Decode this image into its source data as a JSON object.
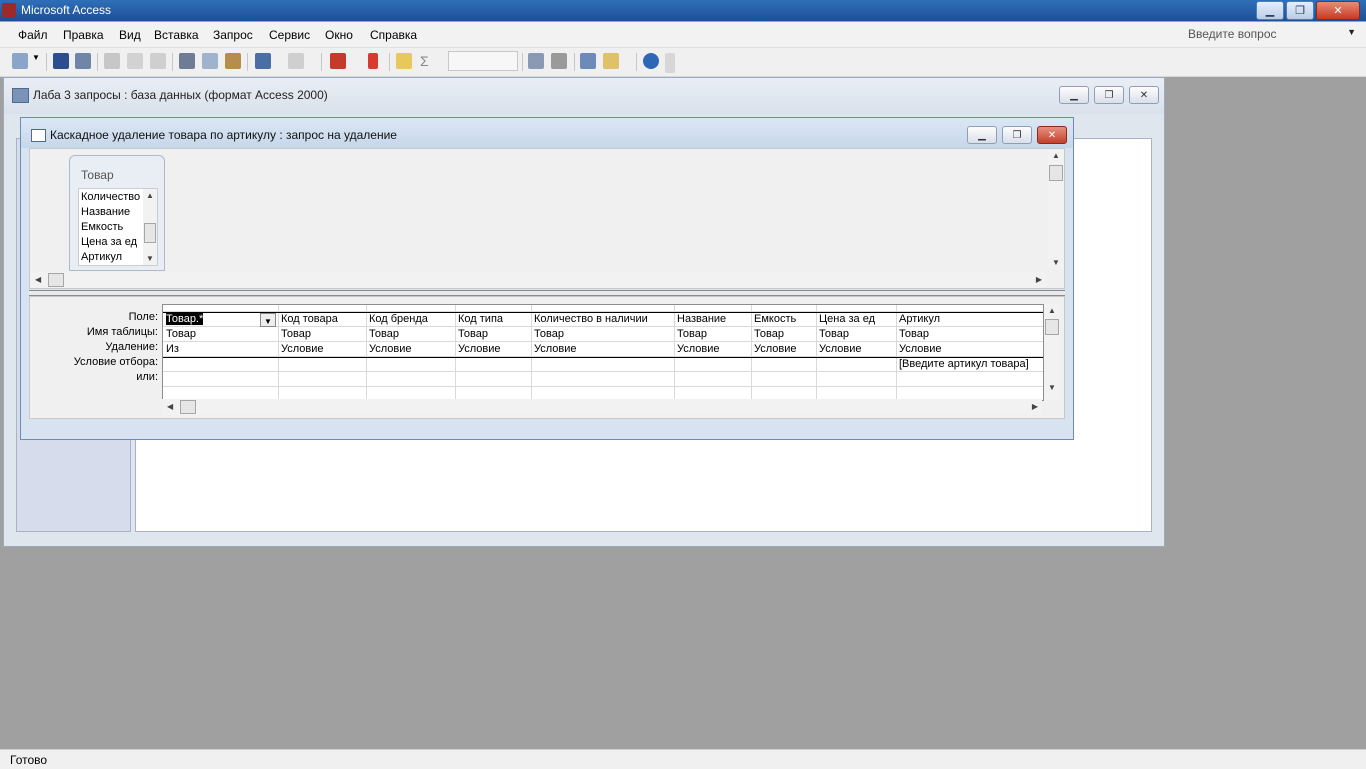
{
  "app": {
    "title": "Microsoft Access"
  },
  "menu": [
    {
      "label": "Файл"
    },
    {
      "label": "Правка"
    },
    {
      "label": "Вид"
    },
    {
      "label": "Вставка"
    },
    {
      "label": "Запрос"
    },
    {
      "label": "Сервис"
    },
    {
      "label": "Окно"
    },
    {
      "label": "Справка"
    }
  ],
  "help_box": {
    "placeholder": "Введите вопрос"
  },
  "db_window": {
    "title": "Лаба 3 запросы : база данных (формат Access 2000)"
  },
  "query_window": {
    "title": "Каскадное удаление товара по артикулу : запрос на удаление",
    "table": {
      "name": "Товар",
      "fields": [
        "Количество",
        "Название",
        "Емкость",
        "Цена за ед",
        "Артикул"
      ]
    },
    "grid": {
      "row_labels": [
        "Поле:",
        "Имя таблицы:",
        "Удаление:",
        "Условие отбора:",
        "или:"
      ],
      "columns": [
        {
          "field": "Товар.*",
          "table": "Товар",
          "delete": "Из",
          "criteria": ""
        },
        {
          "field": "Код товара",
          "table": "Товар",
          "delete": "Условие",
          "criteria": ""
        },
        {
          "field": "Код бренда",
          "table": "Товар",
          "delete": "Условие",
          "criteria": ""
        },
        {
          "field": "Код типа",
          "table": "Товар",
          "delete": "Условие",
          "criteria": ""
        },
        {
          "field": "Количество в наличии",
          "table": "Товар",
          "delete": "Условие",
          "criteria": ""
        },
        {
          "field": "Название",
          "table": "Товар",
          "delete": "Условие",
          "criteria": ""
        },
        {
          "field": "Емкость",
          "table": "Товар",
          "delete": "Условие",
          "criteria": ""
        },
        {
          "field": "Цена за ед",
          "table": "Товар",
          "delete": "Условие",
          "criteria": ""
        },
        {
          "field": "Артикул",
          "table": "Товар",
          "delete": "Условие",
          "criteria": "[Введите артикул товара]"
        }
      ]
    }
  },
  "status": {
    "text": "Готово"
  },
  "colors": {
    "title_bar": "#1d4f97",
    "workspace": "#a0a0a0",
    "selection": "#000000"
  }
}
